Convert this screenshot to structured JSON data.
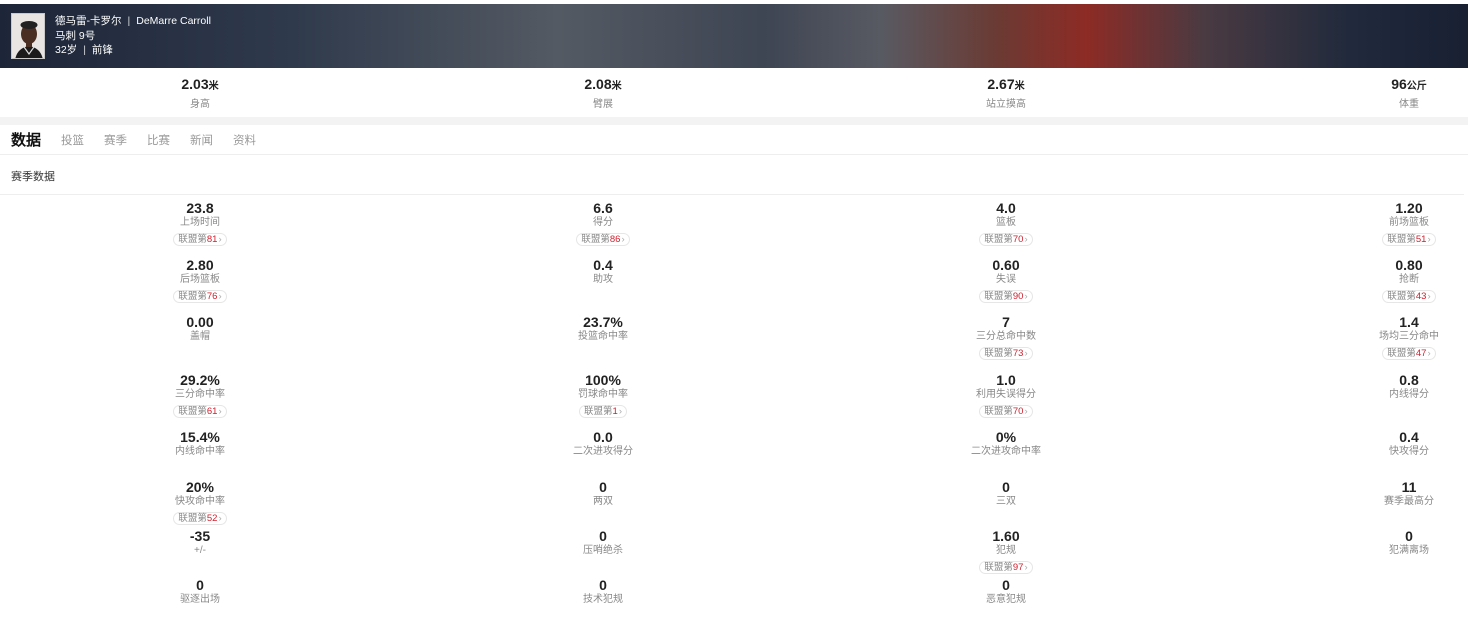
{
  "player": {
    "name_cn": "德马雷-卡罗尔",
    "name_en": "DeMarre Carroll",
    "team_number": "马刺 9号",
    "age": "32岁",
    "position": "前锋"
  },
  "measurements": [
    {
      "value": "2.03",
      "unit": "米",
      "label": "身高"
    },
    {
      "value": "2.08",
      "unit": "米",
      "label": "臂展"
    },
    {
      "value": "2.67",
      "unit": "米",
      "label": "站立摸高"
    },
    {
      "value": "96",
      "unit": "公斤",
      "label": "体重"
    }
  ],
  "tabs": [
    "数据",
    "投篮",
    "赛季",
    "比赛",
    "新闻",
    "资料"
  ],
  "section_title": "赛季数据",
  "rank_prefix": "联盟第",
  "stats": [
    {
      "value": "23.8",
      "label": "上场时间",
      "rank": "81"
    },
    {
      "value": "6.6",
      "label": "得分",
      "rank": "86"
    },
    {
      "value": "4.0",
      "label": "篮板",
      "rank": "70"
    },
    {
      "value": "1.20",
      "label": "前场篮板",
      "rank": "51"
    },
    {
      "value": "2.80",
      "label": "后场篮板",
      "rank": "76"
    },
    {
      "value": "0.4",
      "label": "助攻",
      "rank": null
    },
    {
      "value": "0.60",
      "label": "失误",
      "rank": "90"
    },
    {
      "value": "0.80",
      "label": "抢断",
      "rank": "43"
    },
    {
      "value": "0.00",
      "label": "盖帽",
      "rank": null
    },
    {
      "value": "23.7%",
      "label": "投篮命中率",
      "rank": null
    },
    {
      "value": "7",
      "label": "三分总命中数",
      "rank": "73"
    },
    {
      "value": "1.4",
      "label": "场均三分命中",
      "rank": "47"
    },
    {
      "value": "29.2%",
      "label": "三分命中率",
      "rank": "61"
    },
    {
      "value": "100%",
      "label": "罚球命中率",
      "rank": "1"
    },
    {
      "value": "1.0",
      "label": "利用失误得分",
      "rank": "70"
    },
    {
      "value": "0.8",
      "label": "内线得分",
      "rank": null
    },
    {
      "value": "15.4%",
      "label": "内线命中率",
      "rank": null
    },
    {
      "value": "0.0",
      "label": "二次进攻得分",
      "rank": null
    },
    {
      "value": "0%",
      "label": "二次进攻命中率",
      "rank": null
    },
    {
      "value": "0.4",
      "label": "快攻得分",
      "rank": null
    },
    {
      "value": "20%",
      "label": "快攻命中率",
      "rank": "52"
    },
    {
      "value": "0",
      "label": "两双",
      "rank": null
    },
    {
      "value": "0",
      "label": "三双",
      "rank": null
    },
    {
      "value": "11",
      "label": "赛季最高分",
      "rank": null
    },
    {
      "value": "-35",
      "label": "+/-",
      "rank": null
    },
    {
      "value": "0",
      "label": "压哨绝杀",
      "rank": null
    },
    {
      "value": "1.60",
      "label": "犯规",
      "rank": "97"
    },
    {
      "value": "0",
      "label": "犯满离场",
      "rank": null
    },
    {
      "value": "0",
      "label": "驱逐出场",
      "rank": null
    },
    {
      "value": "0",
      "label": "技术犯规",
      "rank": null
    },
    {
      "value": "0",
      "label": "恶意犯规",
      "rank": null
    }
  ]
}
